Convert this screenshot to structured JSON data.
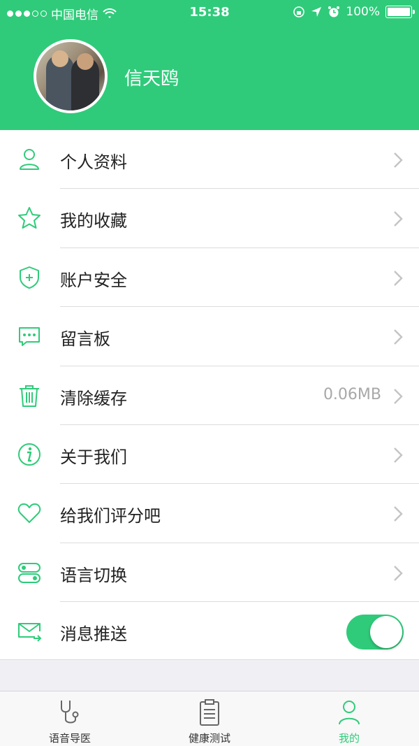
{
  "status_bar": {
    "carrier": "中国电信",
    "time": "15:38",
    "battery": "100%"
  },
  "profile": {
    "name": "信天鸥"
  },
  "menu": {
    "items": [
      {
        "label": "个人资料",
        "icon": "person-icon"
      },
      {
        "label": "我的收藏",
        "icon": "star-icon"
      },
      {
        "label": "账户安全",
        "icon": "shield-icon"
      },
      {
        "label": "留言板",
        "icon": "message-icon"
      },
      {
        "label": "清除缓存",
        "icon": "trash-icon",
        "value": "0.06MB"
      },
      {
        "label": "关于我们",
        "icon": "info-icon"
      },
      {
        "label": "给我们评分吧",
        "icon": "heart-icon"
      },
      {
        "label": "语言切换",
        "icon": "switch-icon"
      },
      {
        "label": "消息推送",
        "icon": "mail-icon",
        "toggle": true
      }
    ]
  },
  "tabbar": {
    "tabs": [
      {
        "label": "语音导医",
        "icon": "stethoscope-icon",
        "active": false
      },
      {
        "label": "健康测试",
        "icon": "clipboard-icon",
        "active": false
      },
      {
        "label": "我的",
        "icon": "person-icon",
        "active": true
      }
    ]
  },
  "colors": {
    "accent": "#2fcb7a",
    "text": "#222222",
    "muted": "#a8a8a8"
  }
}
